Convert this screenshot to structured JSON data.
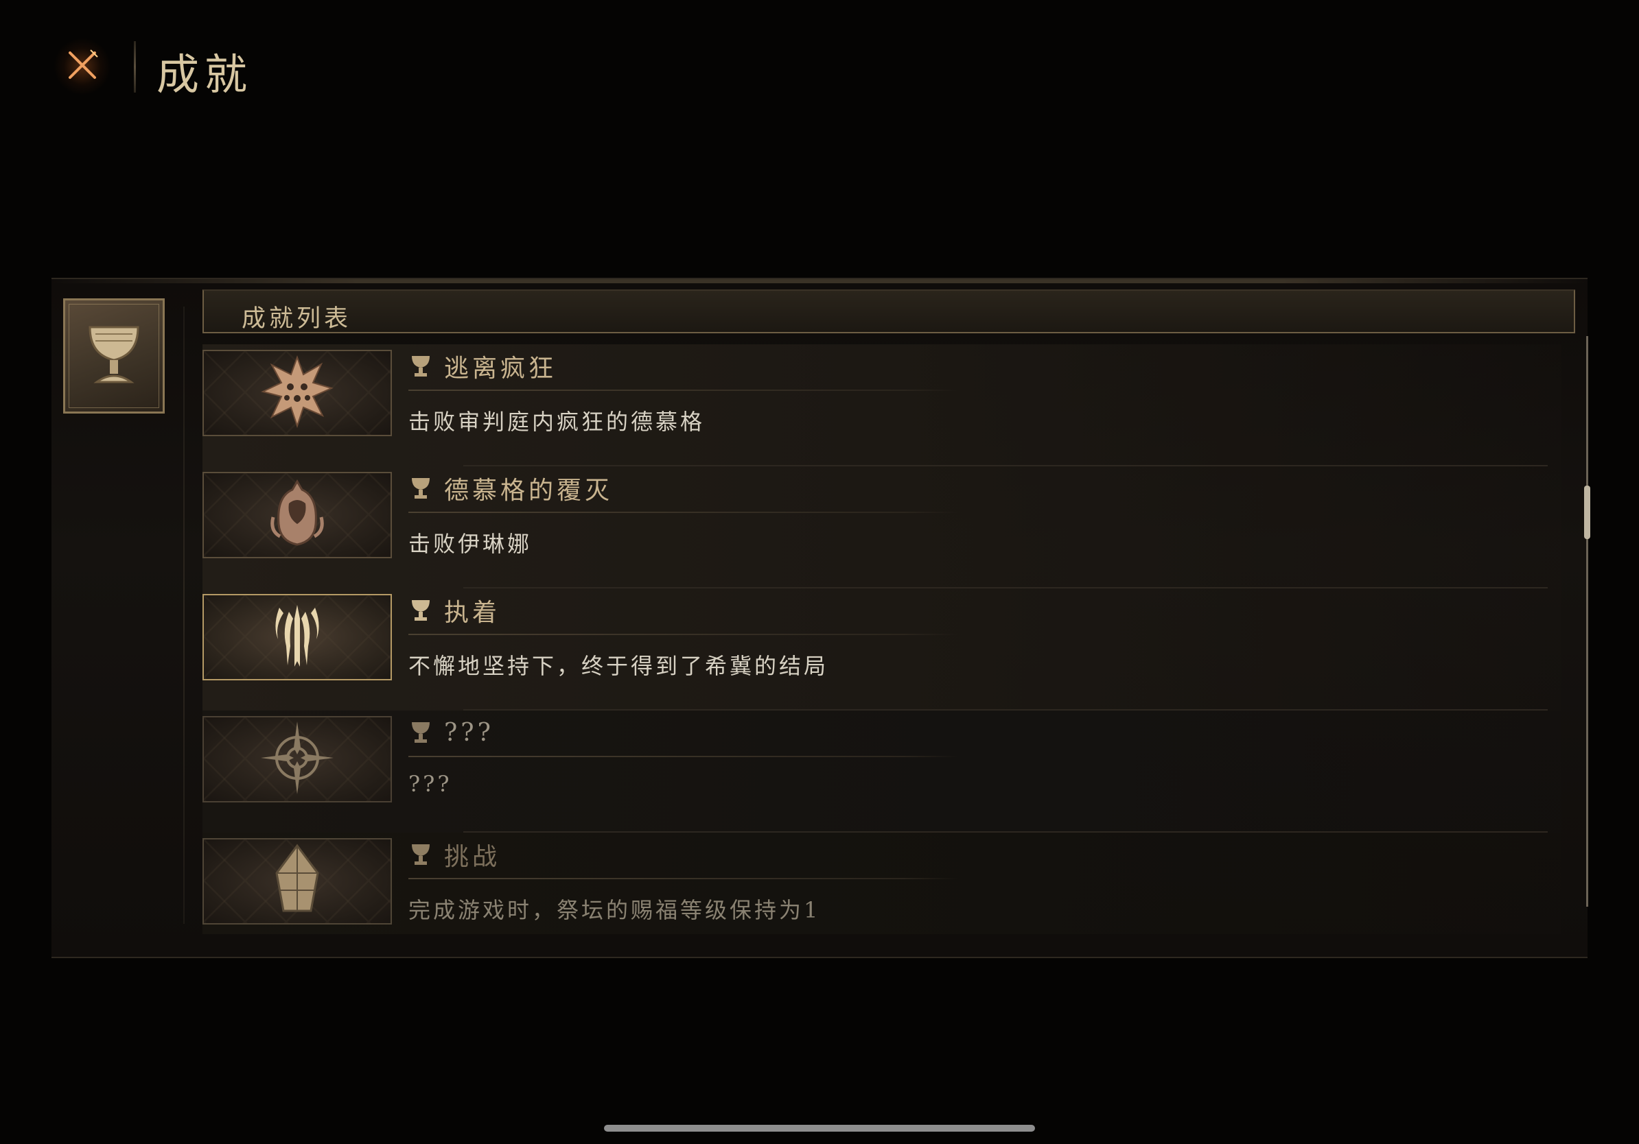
{
  "header": {
    "title": "成就",
    "close_icon": "close-x-icon"
  },
  "colors": {
    "accent_gold": "#c9b48f",
    "close_glow": "#dc6e28",
    "text_light": "#d8d2c4"
  },
  "sidebar": {
    "category_icon": "chalice-icon"
  },
  "list": {
    "header_label": "成就列表",
    "items": [
      {
        "title": "逃离疯狂",
        "description": "击败审判庭内疯狂的德慕格",
        "icon": "spiked-star-icon",
        "unlocked": true
      },
      {
        "title": "德慕格的覆灭",
        "description": "击败伊琳娜",
        "icon": "hooded-figure-icon",
        "unlocked": true
      },
      {
        "title": "执着",
        "description": "不懈地坚持下，终于得到了希冀的结局",
        "icon": "clawed-crest-icon",
        "unlocked": true
      },
      {
        "title": "???",
        "description": "???",
        "icon": "compass-star-icon",
        "unlocked": false
      },
      {
        "title": "挑战",
        "description": "完成游戏时，祭坛的赐福等级保持为1",
        "icon": "crystal-shard-icon",
        "unlocked": true
      }
    ]
  }
}
